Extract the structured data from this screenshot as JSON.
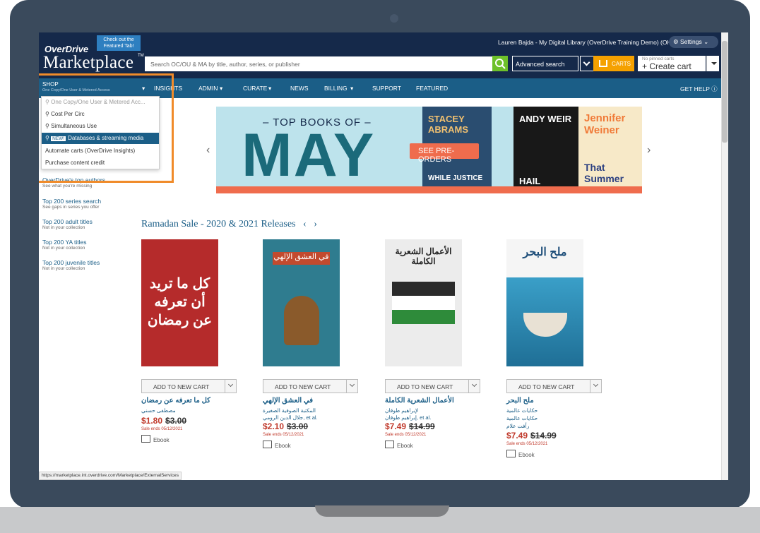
{
  "header": {
    "logo_top": "OverDrive",
    "logo_main": "Marketplace",
    "logo_tm": "TM",
    "promo": "Check out the Featured Tab!",
    "search_placeholder": "Search OC/OU & MA by title, author, series, or publisher",
    "advanced_search": "Advanced search",
    "user": "Lauren Bajda - My Digital Library (OverDrive Training Demo) (OH)",
    "settings": "Settings",
    "carts": "CARTS",
    "pinned": "No pinned carts",
    "create_cart": "+ Create cart"
  },
  "nav": {
    "shop": "SHOP",
    "shop_sub": "One Copy/One User & Metered Access",
    "items": [
      "INSIGHTS",
      "ADMIN",
      "CURATE",
      "NEWS",
      "BILLING",
      "SUPPORT",
      "FEATURED"
    ],
    "help": "GET HELP"
  },
  "dropdown": {
    "items": [
      "One Copy/One User & Metered Acc...",
      "Cost Per Circ",
      "Simultaneous Use",
      "Databases & streaming media",
      "Automate carts (OverDrive Insights)",
      "Purchase content credit"
    ],
    "new_badge": "NEW!"
  },
  "sidebar": [
    {
      "title": "OverDrive's top authors",
      "sub": "See what you're missing"
    },
    {
      "title": "Top 200 series search",
      "sub": "See gaps in series you offer"
    },
    {
      "title": "Top 200 adult titles",
      "sub": "Not in your collection"
    },
    {
      "title": "Top 200 YA titles",
      "sub": "Not in your collection"
    },
    {
      "title": "Top 200 juvenile titles",
      "sub": "Not in your collection"
    }
  ],
  "banner": {
    "top": "– TOP BOOKS OF –",
    "month": "MAY",
    "cta": "SEE PRE-ORDERS",
    "cover1": "STACEY ABRAMS",
    "cover1_sub": "WHILE JUSTICE",
    "cover2": "ANDY WEIR",
    "cover2_sub": "HAIL",
    "cover3": "Jennifer Weiner",
    "cover3_sub": "That Summer"
  },
  "section": {
    "title": "Ramadan Sale - 2020 & 2021 Releases"
  },
  "books": [
    {
      "title": "كل ما تعرفه عن رمضان",
      "author1": "مصطفى حسني",
      "author2": "",
      "sale": "$1.80",
      "list": "$3.00",
      "ends": "Sale ends 05/12/2021",
      "format": "Ebook",
      "add": "ADD TO NEW CART",
      "cover_color": "#b52b2b",
      "cover_text": "كل ما تريد أن تعرفه عن رمضان"
    },
    {
      "title": "في العشق الإلهي",
      "author1": "المكتبة الصوفية الصغيرة",
      "author2": "جلال الدين الرومي, et al.",
      "sale": "$2.10",
      "list": "$3.00",
      "ends": "Sale ends 05/12/2021",
      "format": "Ebook",
      "add": "ADD TO NEW CART",
      "cover_color": "#2f7c8f",
      "cover_text": "في العشق الإلهي"
    },
    {
      "title": "الأعمال الشعرية الكاملة",
      "author1": "لإبراهيم طوقان",
      "author2": "إبراهيم طوقان, et al.",
      "sale": "$7.49",
      "list": "$14.99",
      "ends": "Sale ends 05/12/2021",
      "format": "Ebook",
      "add": "ADD TO NEW CART",
      "cover_color": "#2a2a2a",
      "cover_text": "الأعمال الشعرية الكاملة"
    },
    {
      "title": "ملح البحر",
      "author1": "حكايات عالمية",
      "author2": "حكايات عالمية",
      "author3": "رأفت علام",
      "sale": "$7.49",
      "list": "$14.99",
      "ends": "Sale ends 05/12/2021",
      "format": "Ebook",
      "add": "ADD TO NEW CART",
      "cover_color": "#3a9fc8",
      "cover_text": "ملح البحر"
    }
  ],
  "status_url": "https://marketplace.int.overdrive.com/Marketplace/ExternalServices"
}
